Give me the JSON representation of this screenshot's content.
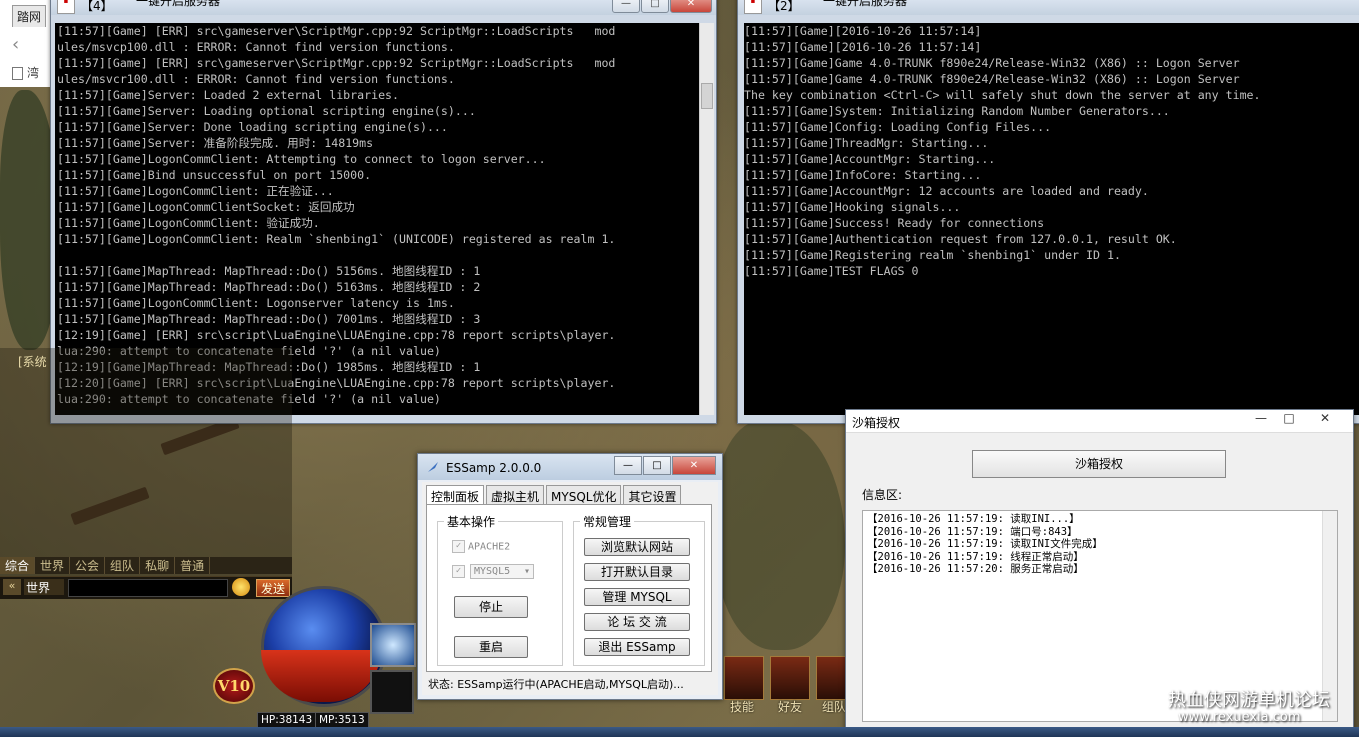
{
  "browser": {
    "tab_text": "踏网",
    "doc_text": "湾"
  },
  "console_left": {
    "badge": "【4】",
    "title": "一键开启服务器",
    "lines": [
      "[11:57][Game] [ERR] src\\gameserver\\ScriptMgr.cpp:92 ScriptMgr::LoadScripts   mod",
      "ules/msvcp100.dll : ERROR: Cannot find version functions.",
      "[11:57][Game] [ERR] src\\gameserver\\ScriptMgr.cpp:92 ScriptMgr::LoadScripts   mod",
      "ules/msvcr100.dll : ERROR: Cannot find version functions.",
      "[11:57][Game]Server: Loaded 2 external libraries.",
      "[11:57][Game]Server: Loading optional scripting engine(s)...",
      "[11:57][Game]Server: Done loading scripting engine(s)...",
      "[11:57][Game]Server: 准备阶段完成. 用时: 14819ms",
      "[11:57][Game]LogonCommClient: Attempting to connect to logon server...",
      "[11:57][Game]Bind unsuccessful on port 15000.",
      "[11:57][Game]LogonCommClient: 正在验证...",
      "[11:57][Game]LogonCommClientSocket: 返回成功",
      "[11:57][Game]LogonCommClient: 验证成功.",
      "[11:57][Game]LogonCommClient: Realm `shenbing1` (UNICODE) registered as realm 1.",
      "",
      "[11:57][Game]MapThread: MapThread::Do() 5156ms. 地图线程ID : 1",
      "[11:57][Game]MapThread: MapThread::Do() 5163ms. 地图线程ID : 2",
      "[11:57][Game]LogonCommClient: Logonserver latency is 1ms.",
      "[11:57][Game]MapThread: MapThread::Do() 7001ms. 地图线程ID : 3",
      "[12:19][Game] [ERR] src\\script\\LuaEngine\\LUAEngine.cpp:78 report scripts\\player.",
      "lua:290: attempt to concatenate field '?' (a nil value)",
      "[12:19][Game]MapThread: MapThread::Do() 1985ms. 地图线程ID : 1",
      "[12:20][Game] [ERR] src\\script\\LuaEngine\\LUAEngine.cpp:78 report scripts\\player.",
      "lua:290: attempt to concatenate field '?' (a nil value)"
    ]
  },
  "console_right": {
    "badge": "【2】",
    "title": "一键开启服务器",
    "lines": [
      "[11:57][Game][2016-10-26 11:57:14]",
      "[11:57][Game][2016-10-26 11:57:14]",
      "[11:57][Game]Game 4.0-TRUNK f890e24/Release-Win32 (X86) :: Logon Server",
      "[11:57][Game]Game 4.0-TRUNK f890e24/Release-Win32 (X86) :: Logon Server",
      "The key combination <Ctrl-C> will safely shut down the server at any time.",
      "[11:57][Game]System: Initializing Random Number Generators...",
      "[11:57][Game]Config: Loading Config Files...",
      "[11:57][Game]ThreadMgr: Starting...",
      "[11:57][Game]AccountMgr: Starting...",
      "[11:57][Game]InfoCore: Starting...",
      "[11:57][Game]AccountMgr: 12 accounts are loaded and ready.",
      "[11:57][Game]Hooking signals...",
      "[11:57][Game]Success! Ready for connections",
      "[11:57][Game]Authentication request from 127.0.0.1, result OK.",
      "[11:57][Game]Registering realm `shenbing1` under ID 1.",
      "[11:57][Game]TEST FLAGS 0"
    ]
  },
  "essamp": {
    "title": "ESSamp 2.0.0.0",
    "tabs": [
      "控制面板",
      "虚拟主机",
      "MYSQL优化",
      "其它设置"
    ],
    "basic_group": "基本操作",
    "apache_label": "APACHE2",
    "mysql_select": "MYSQL5",
    "stop_button": "停止",
    "restart_button": "重启",
    "common_group": "常规管理",
    "browse_button": "浏览默认网站",
    "open_dir_button": "打开默认目录",
    "manage_mysql_button": "管理  MYSQL",
    "forum_button": "论 坛 交 流",
    "exit_button": "退出  ESSamp",
    "status": "状态: ESSamp运行中(APACHE启动,MYSQL启动)..."
  },
  "sandbox": {
    "title": "沙箱授权",
    "button": "沙箱授权",
    "info_label": "信息区:",
    "log": [
      "【2016-10-26 11:57:19: 读取INI...】",
      "【2016-10-26 11:57:19: 端口号:843】",
      "【2016-10-26 11:57:19: 读取INI文件完成】",
      "【2016-10-26 11:57:19: 线程正常启动】",
      "【2016-10-26 11:57:20: 服务正常启动】"
    ]
  },
  "game": {
    "system_line": "[系统",
    "chat_tabs": [
      "综合",
      "世界",
      "公会",
      "组队",
      "私聊",
      "普通"
    ],
    "channel": "世界",
    "send": "发送",
    "level": "V10",
    "hp": "HP:38143",
    "mp": "MP:3513",
    "right_buttons": [
      "技能",
      "好友",
      "组队"
    ]
  },
  "watermark": {
    "line1": "热血侠网游单机论坛",
    "line2": "www.rexuexia.com"
  }
}
